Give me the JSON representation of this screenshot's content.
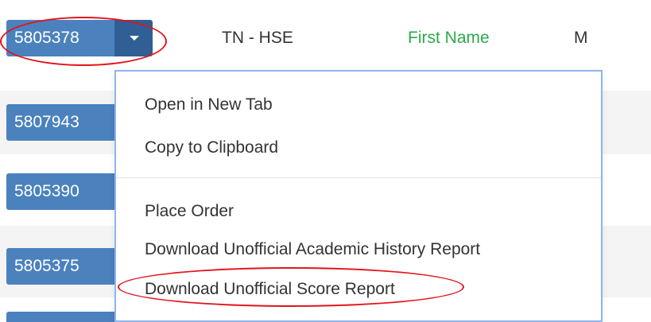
{
  "rows": [
    {
      "id": "5805378",
      "program": "TN - HSE",
      "first_name": "First Name",
      "gender": "M"
    },
    {
      "id": "5807943"
    },
    {
      "id": "5805390"
    },
    {
      "id": "5805375"
    },
    {
      "id": ""
    }
  ],
  "menu": {
    "items": [
      {
        "label": "Open in New Tab"
      },
      {
        "label": "Copy to Clipboard"
      },
      {
        "label": "Place Order"
      },
      {
        "label": "Download Unofficial Academic History Report"
      },
      {
        "label": "Download Unofficial Score Report"
      }
    ]
  },
  "colors": {
    "id_button": "#4b82bd",
    "caret_button": "#2f5f95",
    "first_name": "#2ea84a",
    "highlight": "#e3131b",
    "menu_border": "#8fb4ee"
  },
  "icons": {
    "caret": "chevron-down-icon"
  }
}
